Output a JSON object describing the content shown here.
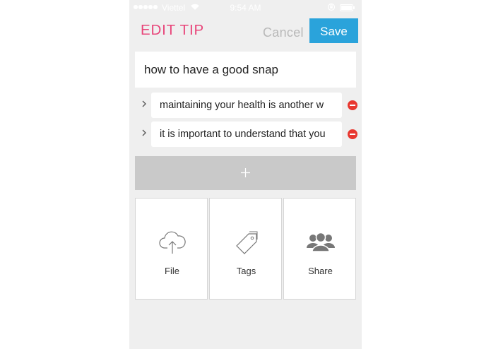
{
  "status_bar": {
    "carrier": "Viettel",
    "time": "9:54 AM",
    "icons": [
      "signal-dots-icon",
      "wifi-icon",
      "rotation-lock-icon",
      "battery-icon"
    ]
  },
  "header": {
    "title": "EDIT TIP",
    "cancel_label": "Cancel",
    "save_label": "Save"
  },
  "tip": {
    "title": "how to have a good snap",
    "items": [
      {
        "text": "maintaining your health is another w",
        "expand_icon": "chevron-right-icon",
        "remove_icon": "remove-minus-icon"
      },
      {
        "text": "it is important to understand that you",
        "expand_icon": "chevron-right-icon",
        "remove_icon": "remove-minus-icon"
      }
    ],
    "add_icon": "plus-icon"
  },
  "actions": [
    {
      "label": "File",
      "icon": "cloud-upload-icon"
    },
    {
      "label": "Tags",
      "icon": "tag-icon"
    },
    {
      "label": "Share",
      "icon": "group-share-icon"
    }
  ],
  "colors": {
    "accent_title": "#e8457a",
    "save_button": "#2aa3db",
    "remove": "#e8372f",
    "background": "#efefef"
  }
}
